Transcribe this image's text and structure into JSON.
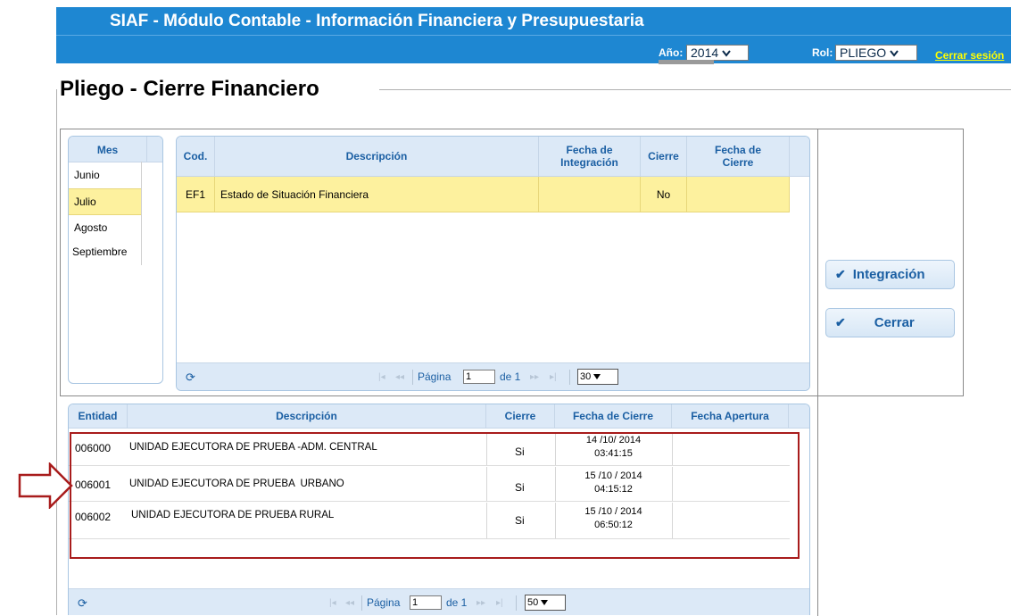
{
  "header": {
    "title": "SIAF - Módulo Contable - Información Financiera y Presupuestaria",
    "anio_label": "Año:",
    "anio_value": "2014",
    "rol_label": "Rol:",
    "rol_value": "PLIEGO",
    "logout_label": "Cerrar sesión"
  },
  "page": {
    "title": "Pliego - Cierre Financiero"
  },
  "months": {
    "header": "Mes",
    "items": [
      "Junio",
      "Julio",
      "Agosto",
      "Septiembre"
    ],
    "selected": "Julio"
  },
  "statements": {
    "columns": {
      "cod": "Cod.",
      "descripcion": "Descripción",
      "fecha_integracion_1": "Fecha de",
      "fecha_integracion_2": "Integración",
      "cierre": "Cierre",
      "fecha_cierre_1": "Fecha de",
      "fecha_cierre_2": "Cierre"
    },
    "rows": [
      {
        "cod": "EF1",
        "descripcion": "Estado de Situación Financiera",
        "fecha_integracion": "",
        "cierre": "No",
        "fecha_cierre": ""
      }
    ],
    "pager": {
      "pagina_label": "Página",
      "page": "1",
      "de_label": "de 1",
      "page_size": "30"
    }
  },
  "actions": {
    "integracion_label": "Integración",
    "cerrar_label": "Cerrar"
  },
  "entities": {
    "columns": {
      "entidad": "Entidad",
      "descripcion": "Descripción",
      "cierre": "Cierre",
      "fecha_cierre": "Fecha de Cierre",
      "fecha_apertura": "Fecha Apertura"
    },
    "rows": [
      {
        "entidad": "006000",
        "descripcion": "UNIDAD EJECUTORA DE PRUEBA -ADM. CENTRAL",
        "cierre": "Si",
        "fecha_cierre_date": "14 /10/ 2014",
        "fecha_cierre_time": "03:41:15",
        "fecha_apertura": ""
      },
      {
        "entidad": "006001",
        "descripcion": "UNIDAD EJECUTORA DE PRUEBA  URBANO",
        "cierre": "Si",
        "fecha_cierre_date": "15 /10 / 2014",
        "fecha_cierre_time": "04:15:12",
        "fecha_apertura": ""
      },
      {
        "entidad": "006002",
        "descripcion": "UNIDAD EJECUTORA DE PRUEBA RURAL",
        "cierre": "Si",
        "fecha_cierre_date": "15 /10 / 2014",
        "fecha_cierre_time": "06:50:12",
        "fecha_apertura": ""
      }
    ],
    "pager": {
      "pagina_label": "Página",
      "page": "1",
      "de_label": "de 1",
      "page_size": "50"
    }
  },
  "annotation": {
    "highlight_color": "#a81c1c",
    "arrow_color": "#a81c1c"
  },
  "colors": {
    "header_blue": "#1e87d2",
    "selected_row": "#fdf19e",
    "grid_header": "#dce9f7"
  }
}
